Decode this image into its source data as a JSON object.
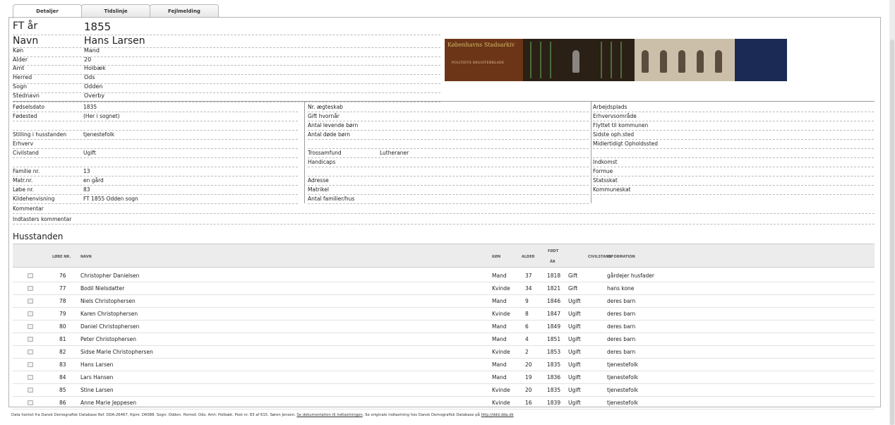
{
  "tabs": [
    "Detaljer",
    "Tidslinje",
    "Fejlmelding"
  ],
  "top": [
    {
      "label": "FT år",
      "value": "1855"
    },
    {
      "label": "Navn",
      "value": "Hans Larsen"
    },
    {
      "label": "Køn",
      "value": "Mand"
    },
    {
      "label": "Alder",
      "value": "20"
    },
    {
      "label": "Amt",
      "value": "Holbæk"
    },
    {
      "label": "Herred",
      "value": "Ods"
    },
    {
      "label": "Sogn",
      "value": "Odden"
    },
    {
      "label": "Stednavn",
      "value": "Overby"
    }
  ],
  "banner": {
    "title": "Københavns Stadsarkiv",
    "subtitle": "POLITIETS REGISTERBLADE"
  },
  "left_col": [
    {
      "label": "Fødselsdato",
      "value": "1835"
    },
    {
      "label": "Fødested",
      "value": "(Her i sognet)"
    },
    {
      "label": "",
      "value": ""
    },
    {
      "label": "Stilling i husstanden",
      "value": "tjenestefolk"
    },
    {
      "label": "Erhverv",
      "value": ""
    },
    {
      "label": "Civilstand",
      "value": "Ugift"
    },
    {
      "label": "",
      "value": ""
    },
    {
      "label": "Familie nr.",
      "value": "13"
    },
    {
      "label": "Matr.nr.",
      "value": "en gård"
    },
    {
      "label": "Løbe nr.",
      "value": "83"
    },
    {
      "label": "Kildehenvisning",
      "value": "FT 1855 Odden sogn"
    }
  ],
  "mid_col": [
    {
      "label": "Nr. ægteskab",
      "value": ""
    },
    {
      "label": "Gift hvornår",
      "value": ""
    },
    {
      "label": "Antal levende børn",
      "value": ""
    },
    {
      "label": "Antal døde børn",
      "value": ""
    },
    {
      "label": "",
      "value": ""
    },
    {
      "label": "Trossamfund",
      "value": "Lutheraner"
    },
    {
      "label": "Handicaps",
      "value": ""
    },
    {
      "label": "",
      "value": ""
    },
    {
      "label": "Adresse",
      "value": ""
    },
    {
      "label": "Matrikel",
      "value": ""
    },
    {
      "label": "Antal familier/hus",
      "value": ""
    }
  ],
  "right_col": [
    {
      "label": "Arbejdsplads",
      "value": ""
    },
    {
      "label": "Erhvervsområde",
      "value": ""
    },
    {
      "label": "Flyttet til kommunen",
      "value": ""
    },
    {
      "label": "Sidste oph.sted",
      "value": ""
    },
    {
      "label": "Midlertidigt Opholdssted",
      "value": ""
    },
    {
      "label": "",
      "value": ""
    },
    {
      "label": "Indkomst",
      "value": ""
    },
    {
      "label": "Formue",
      "value": ""
    },
    {
      "label": "Statsskat",
      "value": ""
    },
    {
      "label": "Kommuneskat",
      "value": ""
    }
  ],
  "comment_label": "Kommentar",
  "indtaster_label": "Indtasters kommentar",
  "household_title": "Husstanden",
  "table": {
    "headers": [
      "LØBE NR.",
      "NAVN",
      "KØN",
      "ALDER",
      "FØDT",
      "ÅR",
      "CIVILSTAND",
      "INFORMATION"
    ],
    "rows": [
      [
        "76",
        "Christopher Danielsen",
        "Mand",
        "37",
        "1818",
        "Gift",
        "gårdejer husfader"
      ],
      [
        "77",
        "Bodil Nielsdatter",
        "Kvinde",
        "34",
        "1821",
        "Gift",
        "hans kone"
      ],
      [
        "78",
        "Niels Christophersen",
        "Mand",
        "9",
        "1846",
        "Ugift",
        "deres barn"
      ],
      [
        "79",
        "Karen Christophersen",
        "Kvinde",
        "8",
        "1847",
        "Ugift",
        "deres barn"
      ],
      [
        "80",
        "Daniel Christophersen",
        "Mand",
        "6",
        "1849",
        "Ugift",
        "deres barn"
      ],
      [
        "81",
        "Peter Christophersen",
        "Mand",
        "4",
        "1851",
        "Ugift",
        "deres barn"
      ],
      [
        "82",
        "Sidse Marie Christophersen",
        "Kvinde",
        "2",
        "1853",
        "Ugift",
        "deres barn"
      ],
      [
        "83",
        "Hans Larsen",
        "Mand",
        "20",
        "1835",
        "Ugift",
        "tjenestefolk"
      ],
      [
        "84",
        "Lars Hansen",
        "Mand",
        "19",
        "1836",
        "Ugift",
        "tjenestefolk"
      ],
      [
        "85",
        "Stine Larsen",
        "Kvinde",
        "20",
        "1835",
        "Ugift",
        "tjenestefolk"
      ],
      [
        "86",
        "Anne Marie Jeppesen",
        "Kvinde",
        "16",
        "1839",
        "Ugift",
        "tjenestefolk"
      ]
    ]
  },
  "footer": {
    "text1": "Data hentet fra Dansk Demografisk Database Ref. DDA-26467, Kipnr. D6088. Sogn: Odden. Herred: Ods. Amt: Holbæk. Post nr. 83 af 615. Søren Jensen. ",
    "link1": "Se dokumentation til indtastningen",
    "text2": ". Se originale indtastning hos Dansk Demografisk Database på ",
    "link2": "http://ddd.dda.dk"
  }
}
